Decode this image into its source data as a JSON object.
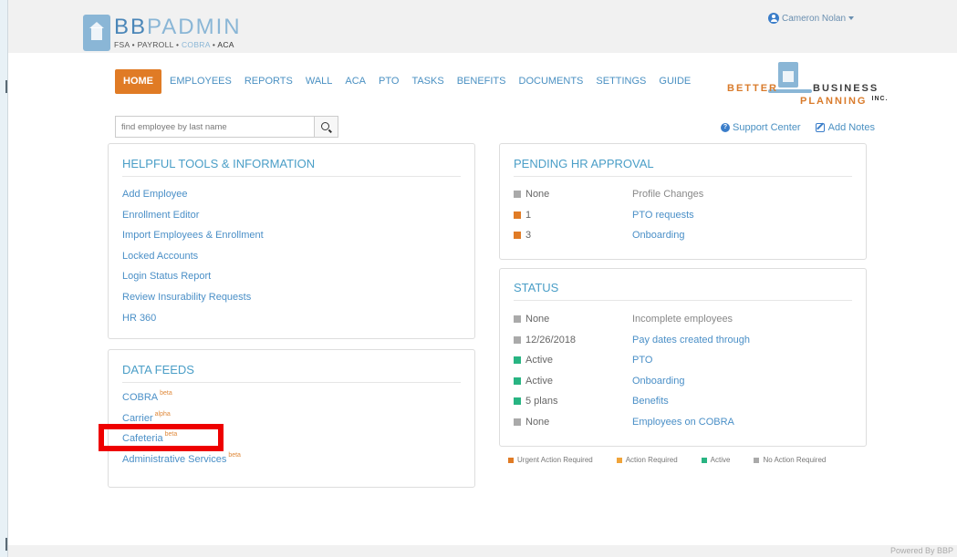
{
  "header": {
    "logo_prefix": "BB",
    "logo_main": "PADMIN",
    "logo_sub": [
      "FSA",
      "PAYROLL",
      "COBRA",
      "ACA"
    ],
    "logo_sub_sep": "•",
    "user_name": "Cameron Nolan"
  },
  "nav": {
    "items": [
      "HOME",
      "EMPLOYEES",
      "REPORTS",
      "WALL",
      "ACA",
      "PTO",
      "TASKS",
      "BENEFITS",
      "DOCUMENTS",
      "SETTINGS",
      "GUIDE"
    ],
    "active": "HOME"
  },
  "brand": {
    "left": "BETTER",
    "right": "BUSINESS",
    "bottom": "PLANNING",
    "inc": "INC."
  },
  "search": {
    "placeholder": "find employee by last name"
  },
  "toolbar": {
    "support": "Support Center",
    "notes": "Add Notes"
  },
  "helpful": {
    "title": "HELPFUL TOOLS & INFORMATION",
    "links": [
      "Add Employee",
      "Enrollment Editor",
      "Import Employees & Enrollment",
      "Locked Accounts",
      "Login Status Report",
      "Review Insurability Requests",
      "HR 360"
    ]
  },
  "feeds": {
    "title": "DATA FEEDS",
    "items": [
      {
        "label": "COBRA",
        "tag": "beta"
      },
      {
        "label": "Carrier",
        "tag": "alpha"
      },
      {
        "label": "Cafeteria",
        "tag": "beta"
      },
      {
        "label": "Administrative Services",
        "tag": "beta"
      }
    ]
  },
  "pending": {
    "title": "PENDING HR APPROVAL",
    "rows": [
      {
        "status": "gray",
        "key": "None",
        "value": "Profile Changes",
        "link": false
      },
      {
        "status": "orange",
        "key": "1",
        "value": "PTO requests",
        "link": true
      },
      {
        "status": "orange",
        "key": "3",
        "value": "Onboarding",
        "link": true
      }
    ]
  },
  "status": {
    "title": "STATUS",
    "rows": [
      {
        "status": "gray",
        "key": "None",
        "value": "Incomplete employees",
        "link": false
      },
      {
        "status": "gray",
        "key": "12/26/2018",
        "value": "Pay dates created through",
        "link": true
      },
      {
        "status": "green",
        "key": "Active",
        "value": "PTO",
        "link": true
      },
      {
        "status": "green",
        "key": "Active",
        "value": "Onboarding",
        "link": true
      },
      {
        "status": "green",
        "key": "5 plans",
        "value": "Benefits",
        "link": true
      },
      {
        "status": "gray",
        "key": "None",
        "value": "Employees on COBRA",
        "link": true
      }
    ]
  },
  "legend": [
    {
      "color": "orange",
      "label": "Urgent Action Required"
    },
    {
      "color": "amber",
      "label": "Action Required"
    },
    {
      "color": "green",
      "label": "Active"
    },
    {
      "color": "gray",
      "label": "No Action Required"
    }
  ],
  "colors": {
    "accent": "#e07b25",
    "link": "#4a8fc7",
    "active": "#28b482",
    "neutral": "#aaaaaa",
    "highlight": "#ee0000"
  },
  "footer": {
    "powered": "Powered By BBP"
  }
}
